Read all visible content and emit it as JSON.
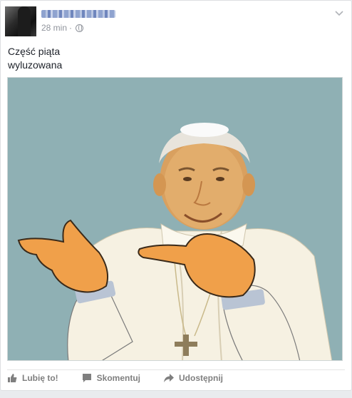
{
  "post": {
    "author_name": "",
    "timestamp": "28 min",
    "separator": "·",
    "privacy_icon": "globe-icon",
    "text_line1": "Część piąta",
    "text_line2": "wyluzowana",
    "image_description_icon": "meme-image"
  },
  "actions": {
    "like_label": "Lubię to!",
    "comment_label": "Skomentuj",
    "share_label": "Udostępnij"
  },
  "colors": {
    "link_blue": "#365899",
    "meta_gray": "#90949c",
    "photo_bg": "#8fb0b4"
  }
}
